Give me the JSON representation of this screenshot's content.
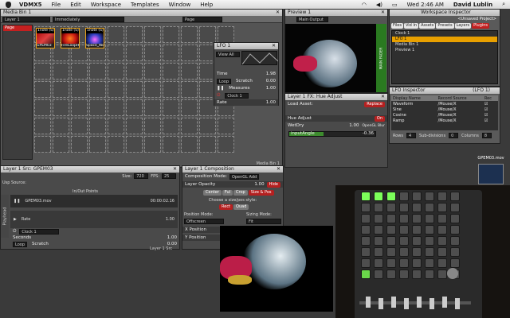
{
  "menubar": {
    "app": "VDMX5",
    "items": [
      "File",
      "Edit",
      "Workspace",
      "Templates",
      "Window",
      "Help"
    ],
    "clock": "Wed 2:46 AM",
    "user": "David Lublin"
  },
  "media_bin": {
    "title": "Media Bin 1",
    "layer_select": "Layer 1",
    "mode_select": "Immediately",
    "page_select": "Page",
    "page_label": "Page",
    "clips": [
      {
        "label": "1note (S)",
        "caption": "GPEM03"
      },
      {
        "label": "1note (S)",
        "caption": "FireLoopHeavy"
      },
      {
        "label": "1note (S)",
        "caption": "Space_World"
      }
    ],
    "footer": "Media Bin 1"
  },
  "lfo": {
    "title": "LFO 1",
    "view": "View All",
    "time_label": "Time",
    "time_value": "1.98",
    "loop_label": "Loop",
    "scratch_label": "Scratch",
    "scratch_value": "0.00",
    "measures_label": "Measures",
    "measures_value": "1.00",
    "clock_label": "Clock 1",
    "rate_label": "Rate",
    "rate_value": "1.00"
  },
  "preview": {
    "title": "Preview 1",
    "source": "Main Output",
    "side_label": "MAIN FADER"
  },
  "fx": {
    "title": "Layer 1 FX: Hue Adjust",
    "load_asset": "Load Asset:",
    "replace": "Replace",
    "hue_adjust": "Hue Adjust",
    "on": "On",
    "wetdry_label": "WetDry",
    "wetdry_value": "1.00",
    "wetdry_level": 1.0,
    "opengl": "OpenGL Blur",
    "inputangle_label": "inputAngle",
    "inputangle_value": "-0.36",
    "inputangle_level": 0.4
  },
  "workspace_inspector": {
    "title": "Workspace Inspector",
    "project": "<Unsaved Project>",
    "tabs": [
      "Files",
      "Vid In",
      "Assets",
      "Presets",
      "Layers",
      "Plugins"
    ],
    "active_tab": "Plugins",
    "items": [
      "Clock 1",
      "LFO 1",
      "Media Bin 1",
      "Preview 1"
    ],
    "selected": "LFO 1"
  },
  "lfo_inspector": {
    "title": "LFO Inspector",
    "subtitle": "(LFO 1)",
    "columns": [
      "Display Name",
      "Record Source",
      "Rec"
    ],
    "rows": [
      {
        "name": "Waveform",
        "source": "/Mouse/X"
      },
      {
        "name": "Sine",
        "source": "/Mouse/X"
      },
      {
        "name": "Cosine",
        "source": "/Mouse/X"
      },
      {
        "name": "Ramp",
        "source": "/Mouse/X"
      }
    ],
    "rows_label": "Rows",
    "rows_value": "4",
    "subdiv_label": "Sub-divisions",
    "subdiv_value": "0",
    "columns_label": "Columns",
    "columns_value": "8"
  },
  "desktop": {
    "file_label": "GPEM03.mov"
  },
  "layer_src": {
    "title": "Layer 1 Src: GPEM03",
    "size_label": "Size:",
    "size_value": "720",
    "fps_label": "FPS:",
    "fps_value": "25",
    "loop_source": "Usp Source:",
    "inout": "In/Out Points",
    "clip_name": "GPEM03.mov",
    "timecode": "00:00:02.16",
    "rate_label": "Rate",
    "rate_value": "1.00",
    "clock_label": "Clock 1",
    "seconds_label": "Seconds",
    "seconds_value": "1.00",
    "loop_label": "Loop",
    "scratch_label": "Scratch",
    "scratch_value": "0.00",
    "side_label": "Playhead",
    "footer": "Layer 1 Src"
  },
  "composition": {
    "title": "Layer 1 Composition",
    "mode_label": "Composition Mode:",
    "mode_value": "OpenGL Add",
    "opacity_label": "Layer Opacity",
    "opacity_value": "1.00",
    "hide": "Hide",
    "buttons": [
      "Center",
      "Ful",
      "Crop",
      "Size & Pos"
    ],
    "style_label": "Choose a size/pos style:",
    "style_buttons": [
      "Rect",
      "Quad"
    ],
    "pos_mode_label": "Position Mode:",
    "pos_mode_value": "Offscreen",
    "sizing_label": "Sizing Mode:",
    "sizing_value": "Fit",
    "xpos": "X Position",
    "ypos": "Y Position"
  }
}
